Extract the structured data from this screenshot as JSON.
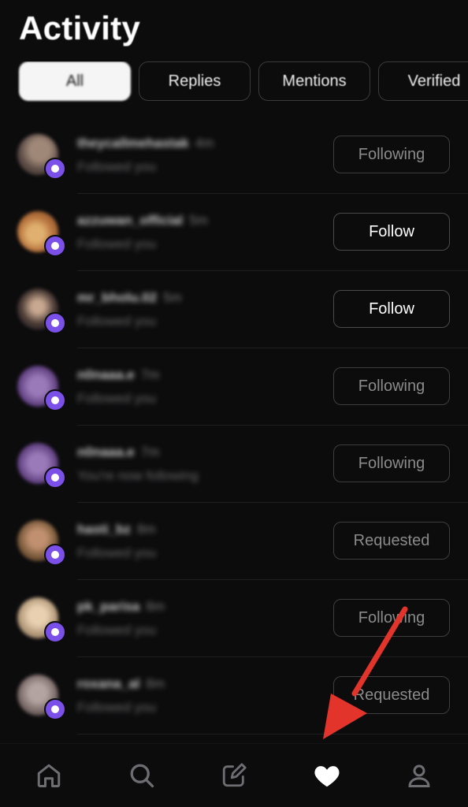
{
  "header": {
    "title": "Activity"
  },
  "tabs": [
    {
      "label": "All",
      "active": true
    },
    {
      "label": "Replies",
      "active": false
    },
    {
      "label": "Mentions",
      "active": false
    },
    {
      "label": "Verified",
      "active": false
    }
  ],
  "activity": [
    {
      "username": "theycallmehastak",
      "time": "4m",
      "subtitle": "Followed you",
      "button": "Following",
      "avatar_color": "#7a6a60"
    },
    {
      "username": "azzuwan_official",
      "time": "5m",
      "subtitle": "Followed you",
      "button": "Follow",
      "avatar_color": "#c48a4a"
    },
    {
      "username": "mr_bholu.02",
      "time": "5m",
      "subtitle": "Followed you",
      "button": "Follow",
      "avatar_color": "#5c4a3a"
    },
    {
      "username": "n0naaa.e",
      "time": "7m",
      "subtitle": "Followed you",
      "button": "Following",
      "avatar_color": "#6a4a8a"
    },
    {
      "username": "n0naaa.e",
      "time": "7m",
      "subtitle": "You're now following",
      "button": "Following",
      "avatar_color": "#6a4a8a"
    },
    {
      "username": "hasti_bz",
      "time": "8m",
      "subtitle": "Followed you",
      "button": "Requested",
      "avatar_color": "#8a6a4a"
    },
    {
      "username": "pk_parisa",
      "time": "8m",
      "subtitle": "Followed you",
      "button": "Following",
      "avatar_color": "#b49a7a"
    },
    {
      "username": "roxana_al",
      "time": "8m",
      "subtitle": "Followed you",
      "button": "Requested",
      "avatar_color": "#7a6a68"
    }
  ],
  "nav": {
    "items": [
      {
        "icon": "home-icon"
      },
      {
        "icon": "search-icon"
      },
      {
        "icon": "compose-icon"
      },
      {
        "icon": "heart-icon",
        "active": true
      },
      {
        "icon": "profile-icon"
      }
    ]
  },
  "colors": {
    "accent_badge": "#7b50e8",
    "annotation_arrow": "#e3342b",
    "background": "#0c0c0d"
  }
}
